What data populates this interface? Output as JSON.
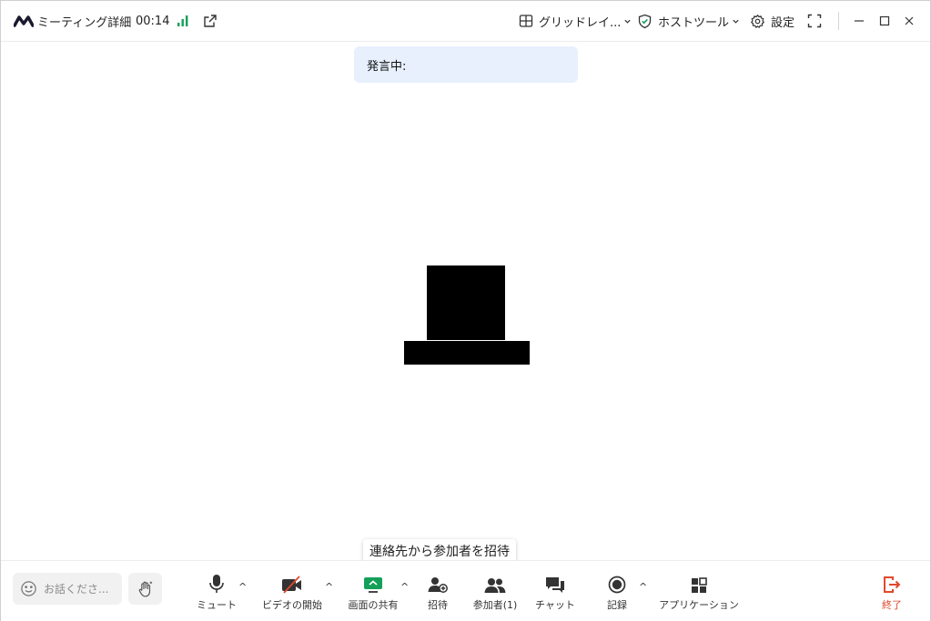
{
  "titlebar": {
    "meeting_details": "ミーティング詳細",
    "timer": "00:14",
    "layout": "グリッドレイ...",
    "host_tools": "ホストツール",
    "settings": "設定"
  },
  "banner": {
    "speaking_label": "発言中:"
  },
  "tooltip": {
    "text": "連絡先から参加者を招待"
  },
  "toolbar": {
    "chat_placeholder": "お話くださ...",
    "mute": "ミュート",
    "start_video": "ビデオの開始",
    "share_screen": "画面の共有",
    "invite": "招待",
    "participants": "参加者(1)",
    "chat": "チャット",
    "record": "記録",
    "apps": "アプリケーション",
    "end": "終了"
  },
  "colors": {
    "accent_green": "#15a05a",
    "end_red": "#e0492c",
    "speaking_bg": "#e8f0fd"
  }
}
